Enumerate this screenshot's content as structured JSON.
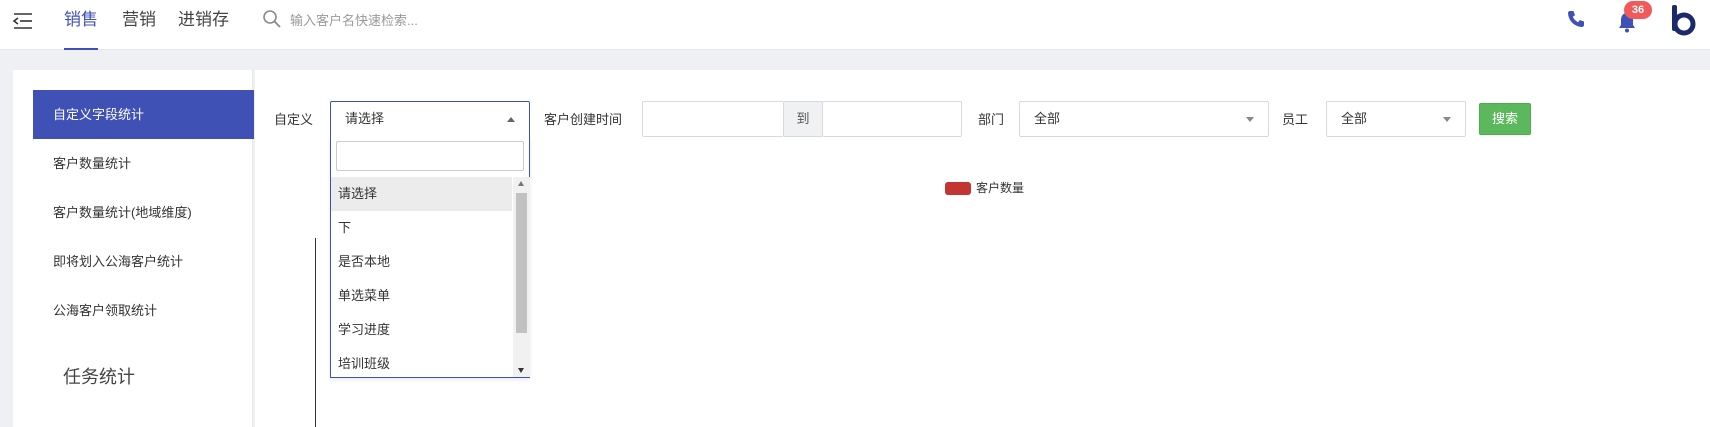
{
  "header": {
    "tabs": [
      {
        "label": "销售",
        "active": true
      },
      {
        "label": "营销",
        "active": false
      },
      {
        "label": "进销存",
        "active": false
      }
    ],
    "search": {
      "placeholder": "输入客户名快速检索...",
      "value": ""
    },
    "notification_count": "36",
    "brand_color": "#3f51b5"
  },
  "sidebar": {
    "items": [
      {
        "label": "自定义字段统计",
        "active": true
      },
      {
        "label": "客户数量统计",
        "active": false
      },
      {
        "label": "客户数量统计(地域维度)",
        "active": false
      },
      {
        "label": "即将划入公海客户统计",
        "active": false
      },
      {
        "label": "公海客户领取统计",
        "active": false
      }
    ],
    "group_title": "任务统计"
  },
  "filters": {
    "custom_label": "自定义",
    "custom_select": {
      "value": "请选择",
      "open": true
    },
    "created_time_label": "客户创建时间",
    "date_start": {
      "value": ""
    },
    "date_sep": "到",
    "date_end": {
      "value": ""
    },
    "department_label": "部门",
    "department_select": {
      "value": "全部"
    },
    "employee_label": "员工",
    "employee_select": {
      "value": "全部"
    },
    "search_button": "搜索"
  },
  "dropdown": {
    "filter_value": "",
    "options": [
      "请选择",
      "下",
      "是否本地",
      "单选菜单",
      "学习进度",
      "培训班级"
    ],
    "highlighted_index": 0
  },
  "chart_data": {
    "type": "bar",
    "series": [
      {
        "name": "客户数量",
        "values": []
      }
    ],
    "categories": [],
    "colors": {
      "客户数量": "#c23531"
    },
    "legend_position": "top-center"
  }
}
